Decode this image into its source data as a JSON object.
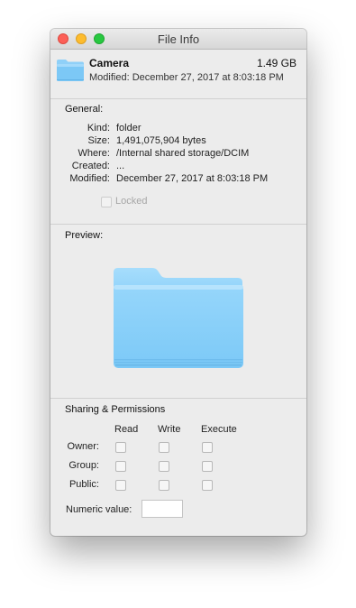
{
  "window": {
    "title": "File Info"
  },
  "header": {
    "name": "Camera",
    "size": "1.49 GB",
    "modified": "Modified: December 27, 2017 at 8:03:18 PM",
    "icon": "folder-icon"
  },
  "general": {
    "title": "General:",
    "rows": [
      {
        "label": "Kind:",
        "value": "folder"
      },
      {
        "label": "Size:",
        "value": "1,491,075,904 bytes"
      },
      {
        "label": "Where:",
        "value": "/Internal shared storage/DCIM"
      },
      {
        "label": "Created:",
        "value": "..."
      },
      {
        "label": "Modified:",
        "value": "December 27, 2017 at 8:03:18 PM"
      }
    ],
    "locked_label": "Locked",
    "locked_checked": false
  },
  "preview": {
    "title": "Preview:",
    "icon": "folder-icon"
  },
  "permissions": {
    "title": "Sharing & Permissions",
    "columns": [
      "Read",
      "Write",
      "Execute"
    ],
    "rows": [
      {
        "label": "Owner:",
        "read": false,
        "write": false,
        "execute": false
      },
      {
        "label": "Group:",
        "read": false,
        "write": false,
        "execute": false
      },
      {
        "label": "Public:",
        "read": false,
        "write": false,
        "execute": false
      }
    ],
    "numeric_label": "Numeric value:",
    "numeric_value": ""
  },
  "colors": {
    "folder_light": "#a9dcfb",
    "folder_mid": "#7fc9f7",
    "folder_dark": "#5fb6ee",
    "close": "#fc5f57",
    "minimize": "#fdbc2e",
    "zoom": "#28c840"
  }
}
